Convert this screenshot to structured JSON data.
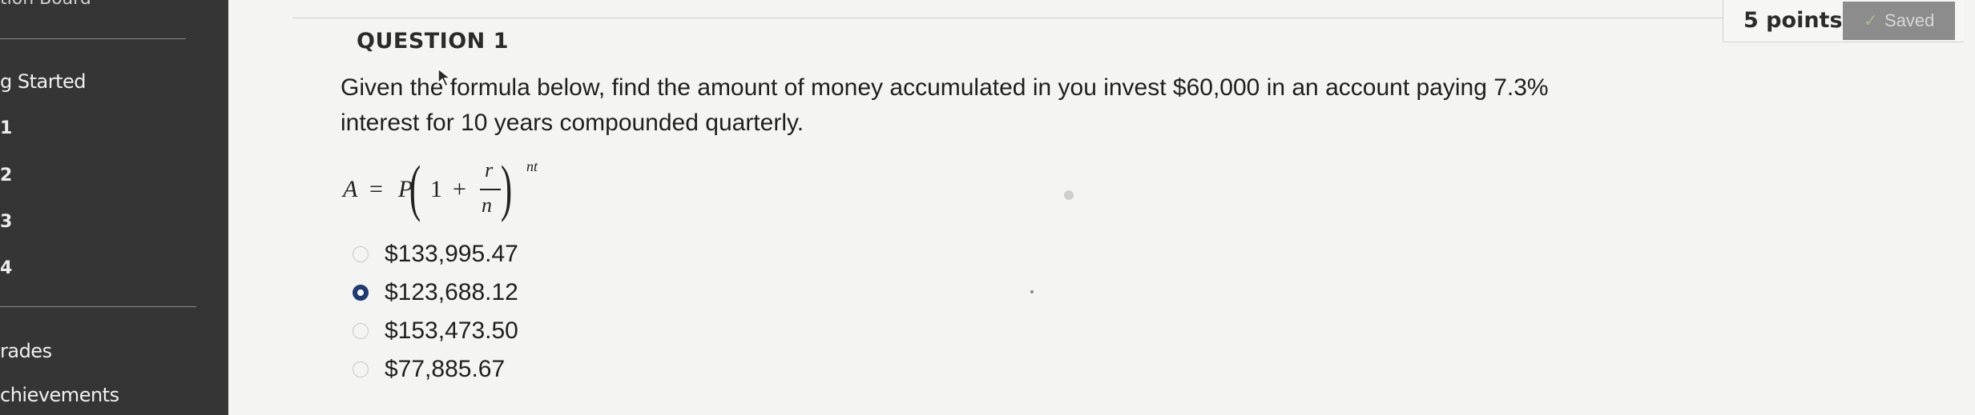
{
  "sidebar": {
    "cropped_top_label": "tion Board",
    "items": [
      {
        "label": "g Started"
      },
      {
        "label": "1"
      },
      {
        "label": "2"
      },
      {
        "label": "3"
      },
      {
        "label": "4"
      },
      {
        "label": "rades"
      },
      {
        "label": "chievements"
      }
    ]
  },
  "question": {
    "title": "QUESTION 1",
    "points": "5 points",
    "saved_label": "Saved",
    "text": "Given the formula below, find the amount of money accumulated in you invest $60,000 in an account paying 7.3% interest for 10 years compounded quarterly.",
    "formula": {
      "lhs": "A",
      "equals": "=",
      "P": "P",
      "one": "1",
      "plus": "+",
      "numerator": "r",
      "denominator": "n",
      "exponent": "nt"
    },
    "options": [
      {
        "label": "$133,995.47",
        "selected": false
      },
      {
        "label": "$123,688.12",
        "selected": true
      },
      {
        "label": "$153,473.50",
        "selected": false
      },
      {
        "label": "$77,885.67",
        "selected": false
      }
    ]
  },
  "colors": {
    "sidebar_bg": "#353535",
    "page_bg": "#f4f4f2",
    "saved_bg": "#8c8c8c",
    "selected_radio": "#1f3b73"
  },
  "icons": {
    "saved": "check-icon",
    "radio": "radio-icon",
    "pointer": "mouse-cursor-icon"
  }
}
